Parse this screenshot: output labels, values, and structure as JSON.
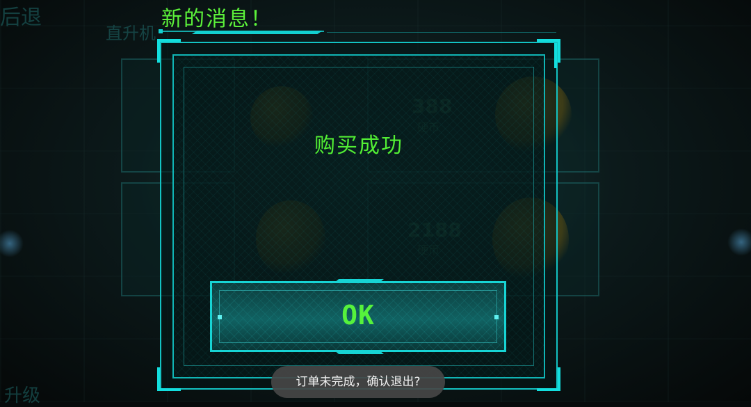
{
  "header": {
    "title": "新的消息！"
  },
  "dialog": {
    "message": "购买成功",
    "ok_label": "OK"
  },
  "toast": {
    "text": "订单未完成，确认退出?"
  },
  "background": {
    "top_left_label": "后退",
    "sub_label": "直升机",
    "bottom_left_label": "升级",
    "tiles": [
      {
        "price": "388",
        "unit": "硬币"
      },
      {
        "price": "2188",
        "unit": "硬币"
      }
    ]
  },
  "colors": {
    "accent_cyan": "#13c3c3",
    "text_green": "#52ee34"
  }
}
